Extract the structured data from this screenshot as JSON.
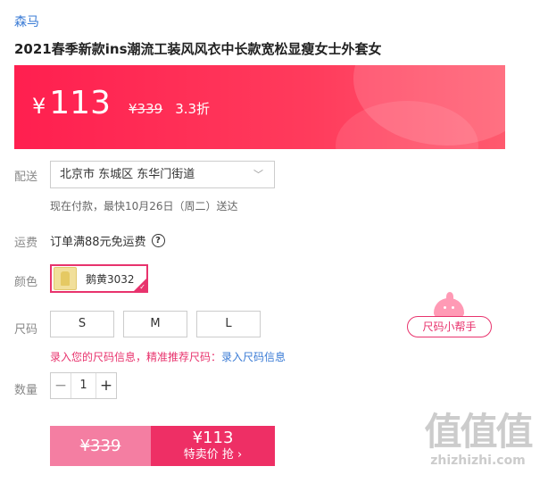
{
  "product": {
    "brand": "森马",
    "title": "2021春季新款ins潮流工装风风衣中长款宽松显瘦女士外套女"
  },
  "price": {
    "currency": "¥",
    "current": "113",
    "original": "¥339",
    "discount": "3.3折"
  },
  "delivery": {
    "label": "配送",
    "address": "北京市 东城区 东华门街道",
    "estimate": "现在付款，最快10月26日（周二）送达"
  },
  "shipping": {
    "label": "运费",
    "text": "订单满88元免运费",
    "help_icon": "?"
  },
  "color": {
    "label": "颜色",
    "selected": "鹅黄3032"
  },
  "size": {
    "label": "尺码",
    "options": [
      "S",
      "M",
      "L"
    ],
    "helper": "尺码小帮手",
    "info_text": "录入您的尺码信息，精准推荐尺码：",
    "info_link": "录入尺码信息"
  },
  "quantity": {
    "label": "数量",
    "value": "1",
    "minus": "−",
    "plus": "+"
  },
  "buy": {
    "original_price": "¥339",
    "price": "¥113",
    "label": "特卖价 抢 ›"
  },
  "watermark": {
    "glyphs": "值值值",
    "text": "zhizhizhi.com"
  },
  "colors": {
    "accent": "#e8336d",
    "banner": "#ff1f4f",
    "link": "#3a7bd5"
  }
}
